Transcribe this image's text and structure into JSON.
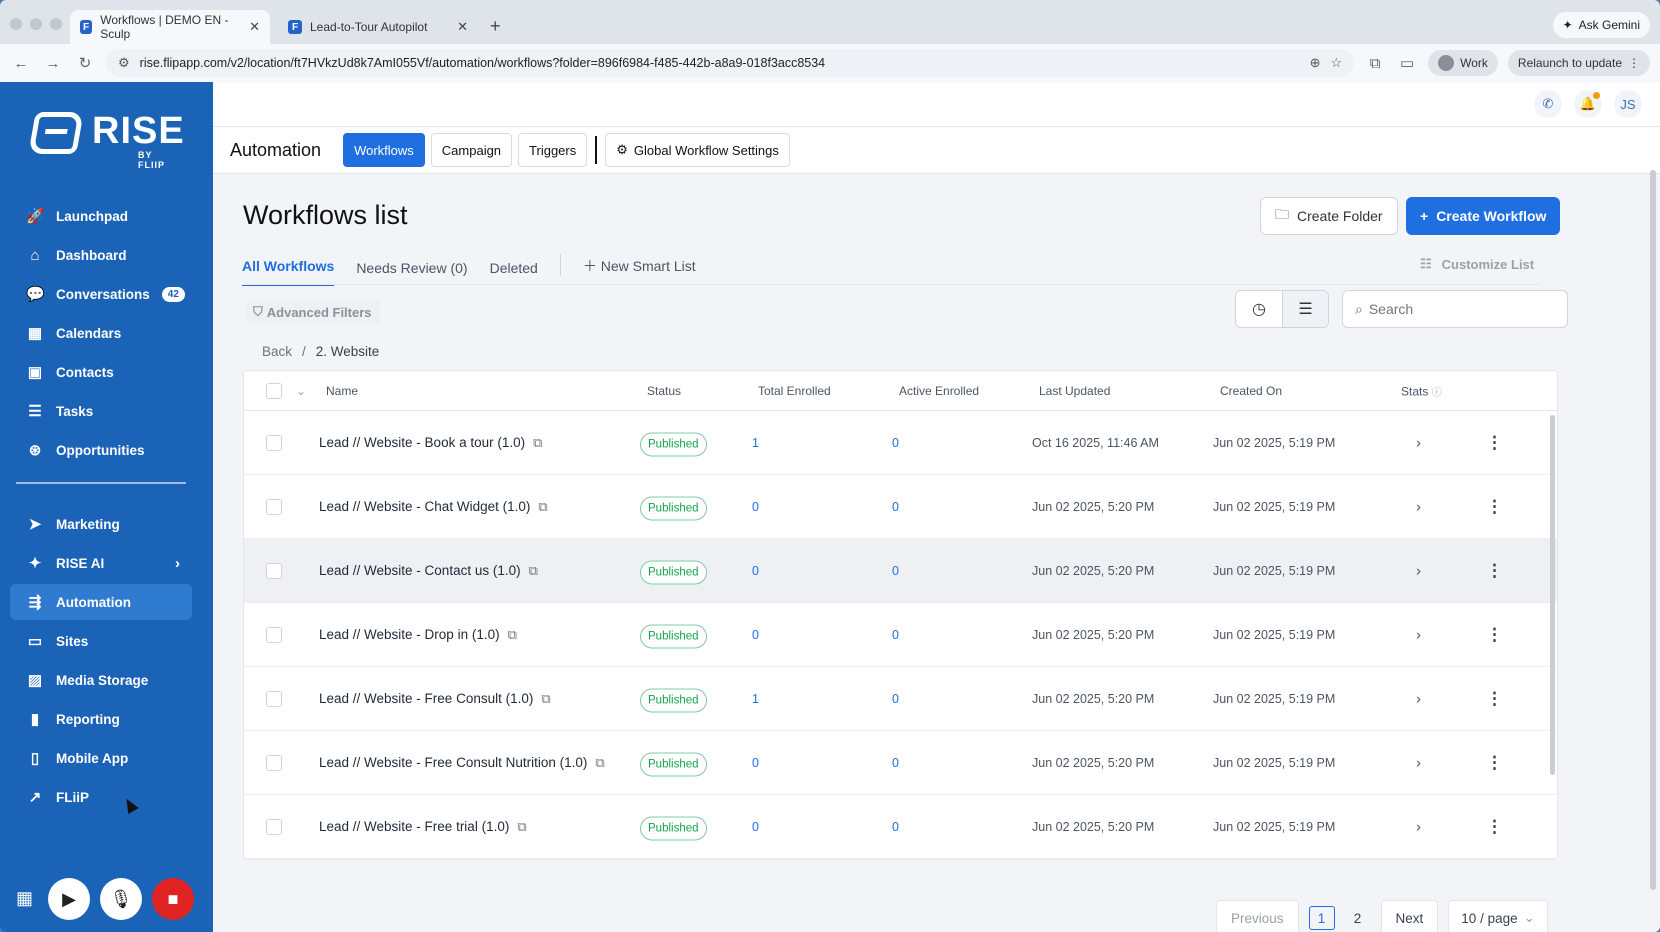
{
  "browser": {
    "tabs": [
      {
        "title": "Workflows | DEMO EN - Sculp",
        "active": true
      },
      {
        "title": "Lead-to-Tour Autopilot",
        "active": false
      }
    ],
    "ask_gemini": "Ask Gemini",
    "url": "rise.flipapp.com/v2/location/ft7HVkzUd8k7AmI055Vf/automation/workflows?folder=896f6984-f485-442b-a8a9-018f3acc8534",
    "profile_label": "Work",
    "relaunch_label": "Relaunch to update"
  },
  "brand": {
    "name": "RISE",
    "sub": "BY FLIIP"
  },
  "sidebar": {
    "items_top": [
      {
        "label": "Launchpad",
        "icon": "rocket-icon"
      },
      {
        "label": "Dashboard",
        "icon": "home-icon"
      },
      {
        "label": "Conversations",
        "icon": "chat-icon",
        "badge": "42"
      },
      {
        "label": "Calendars",
        "icon": "calendar-icon"
      },
      {
        "label": "Contacts",
        "icon": "contact-card-icon"
      },
      {
        "label": "Tasks",
        "icon": "tasks-icon"
      },
      {
        "label": "Opportunities",
        "icon": "target-icon"
      }
    ],
    "items_bottom": [
      {
        "label": "Marketing",
        "icon": "send-icon"
      },
      {
        "label": "RISE AI",
        "icon": "sparkle-icon"
      },
      {
        "label": "Automation",
        "icon": "automation-icon",
        "active": true
      },
      {
        "label": "Sites",
        "icon": "monitor-icon"
      },
      {
        "label": "Media Storage",
        "icon": "image-icon"
      },
      {
        "label": "Reporting",
        "icon": "bar-chart-icon"
      },
      {
        "label": "Mobile App",
        "icon": "phone-icon"
      },
      {
        "label": "FLiiP",
        "icon": "external-link-icon"
      }
    ]
  },
  "topbar": {
    "user_initials": "JS"
  },
  "subnav": {
    "title": "Automation",
    "workflows": "Workflows",
    "campaign": "Campaign",
    "triggers": "Triggers",
    "global_settings": "Global Workflow Settings"
  },
  "page": {
    "title": "Workflows list",
    "create_folder": "Create Folder",
    "create_workflow": "Create Workflow",
    "tabs": {
      "all": "All Workflows",
      "review": "Needs Review (0)",
      "deleted": "Deleted",
      "smart": "New Smart List"
    },
    "customize": "Customize List",
    "advanced_filters": "Advanced Filters",
    "search_placeholder": "Search",
    "breadcrumb": {
      "back": "Back",
      "sep": "/",
      "current": "2. Website"
    }
  },
  "table": {
    "headers": {
      "name": "Name",
      "status": "Status",
      "total": "Total Enrolled",
      "active": "Active Enrolled",
      "updated": "Last Updated",
      "created": "Created On",
      "stats": "Stats"
    },
    "rows": [
      {
        "name": "Lead // Website - Book a tour (1.0)",
        "status": "Published",
        "total": "1",
        "active": "0",
        "updated": "Oct 16 2025, 11:46 AM",
        "created": "Jun 02 2025, 5:19 PM"
      },
      {
        "name": "Lead // Website - Chat Widget (1.0)",
        "status": "Published",
        "total": "0",
        "active": "0",
        "updated": "Jun 02 2025, 5:20 PM",
        "created": "Jun 02 2025, 5:19 PM"
      },
      {
        "name": "Lead // Website - Contact us (1.0)",
        "status": "Published",
        "total": "0",
        "active": "0",
        "updated": "Jun 02 2025, 5:20 PM",
        "created": "Jun 02 2025, 5:19 PM"
      },
      {
        "name": "Lead // Website - Drop in (1.0)",
        "status": "Published",
        "total": "0",
        "active": "0",
        "updated": "Jun 02 2025, 5:20 PM",
        "created": "Jun 02 2025, 5:19 PM"
      },
      {
        "name": "Lead // Website - Free Consult (1.0)",
        "status": "Published",
        "total": "1",
        "active": "0",
        "updated": "Jun 02 2025, 5:20 PM",
        "created": "Jun 02 2025, 5:19 PM"
      },
      {
        "name": "Lead // Website - Free Consult Nutrition (1.0)",
        "status": "Published",
        "total": "0",
        "active": "0",
        "updated": "Jun 02 2025, 5:20 PM",
        "created": "Jun 02 2025, 5:19 PM"
      },
      {
        "name": "Lead // Website - Free trial (1.0)",
        "status": "Published",
        "total": "0",
        "active": "0",
        "updated": "Jun 02 2025, 5:20 PM",
        "created": "Jun 02 2025, 5:19 PM"
      }
    ]
  },
  "pagination": {
    "previous": "Previous",
    "page1": "1",
    "page2": "2",
    "next": "Next",
    "page_size": "10 / page"
  },
  "colors": {
    "sidebar": "#1b63b6",
    "primary": "#1f6fe0",
    "published": "#16a34a"
  }
}
